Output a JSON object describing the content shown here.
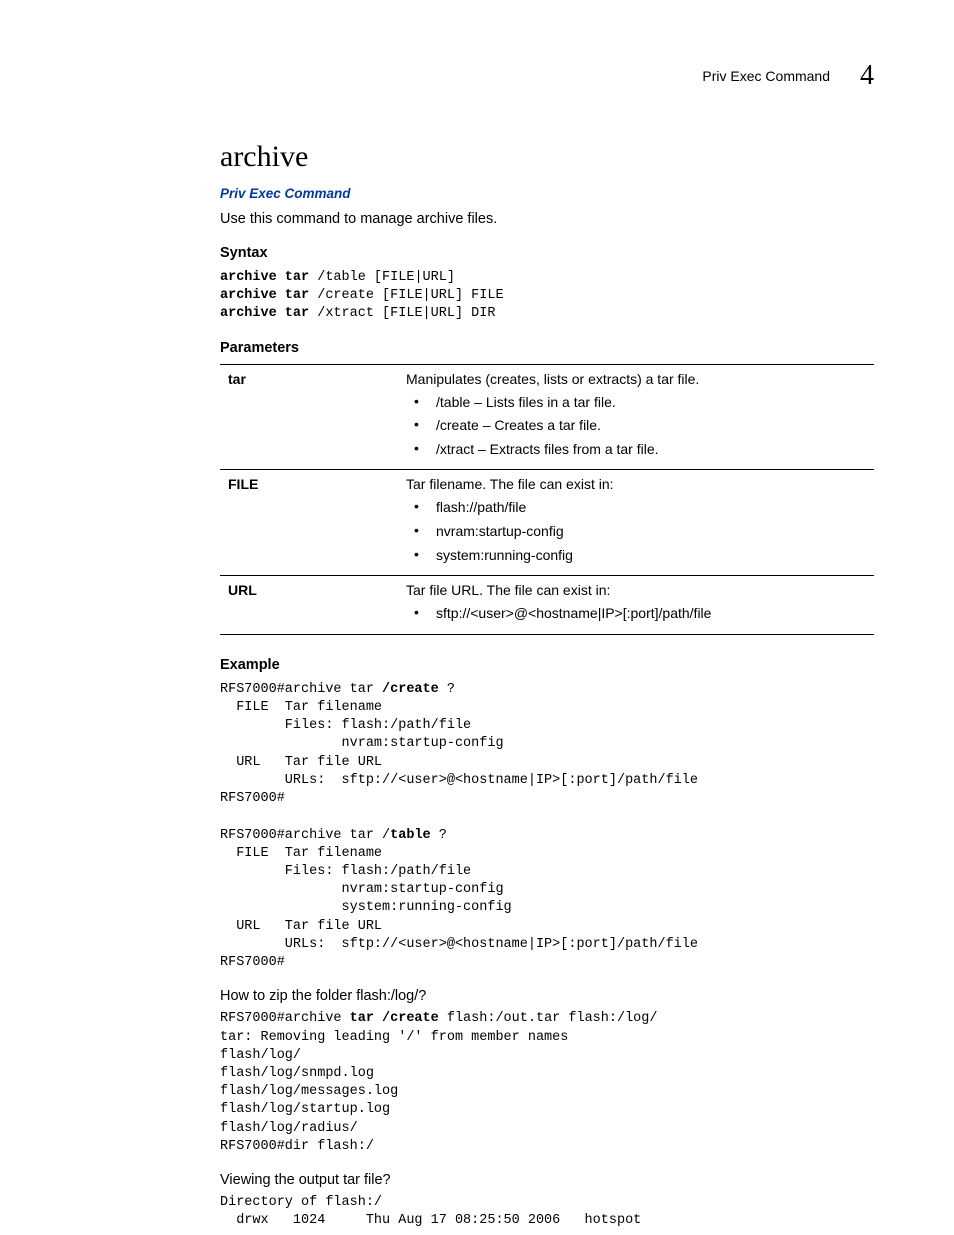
{
  "header": {
    "section": "Priv Exec Command",
    "chapter": "4"
  },
  "title": "archive",
  "link_text": "Priv Exec Command",
  "description": "Use this command to manage archive files.",
  "syntax": {
    "heading": "Syntax",
    "lines_bold": [
      "archive tar",
      "archive tar",
      "archive tar"
    ],
    "lines_rest": [
      " /table [FILE|URL]",
      " /create [FILE|URL] FILE",
      " /xtract [FILE|URL] DIR"
    ]
  },
  "parameters": {
    "heading": "Parameters",
    "rows": [
      {
        "name": "tar",
        "desc": "Manipulates (creates, lists or extracts) a tar file.",
        "bullets": [
          "/table – Lists files in a tar file.",
          "/create – Creates a tar file.",
          "/xtract – Extracts files from a tar file."
        ]
      },
      {
        "name": "FILE",
        "desc": "Tar filename. The file can exist in:",
        "bullets": [
          "flash://path/file",
          "nvram:startup-config",
          "system:running-config"
        ]
      },
      {
        "name": "URL",
        "desc": "Tar file URL. The file can exist in:",
        "bullets": [
          "sftp://<user>@<hostname|IP>[:port]/path/file"
        ]
      }
    ]
  },
  "example": {
    "heading": "Example",
    "block1_pre": "RFS7000#archive tar ",
    "block1_bold": "/create",
    "block1_post": " ?\n  FILE  Tar filename\n        Files: flash:/path/file\n               nvram:startup-config\n  URL   Tar file URL\n        URLs:  sftp://<user>@<hostname|IP>[:port]/path/file\nRFS7000#\n\nRFS7000#archive tar /",
    "block1_bold2": "table",
    "block1_post2": " ?\n  FILE  Tar filename\n        Files: flash:/path/file\n               nvram:startup-config\n               system:running-config\n  URL   Tar file URL\n        URLs:  sftp://<user>@<hostname|IP>[:port]/path/file\nRFS7000#"
  },
  "howto1": {
    "heading": "How to zip the folder flash:/log/?",
    "pre": "RFS7000#archive ",
    "bold": "tar /create",
    "post": " flash:/out.tar flash:/log/\ntar: Removing leading '/' from member names\nflash/log/\nflash/log/snmpd.log\nflash/log/messages.log\nflash/log/startup.log\nflash/log/radius/\nRFS7000#dir flash:/"
  },
  "howto2": {
    "heading": "Viewing the output tar file?",
    "text": "Directory of flash:/\n  drwx   1024     Thu Aug 17 08:25:50 2006   hotspot"
  }
}
